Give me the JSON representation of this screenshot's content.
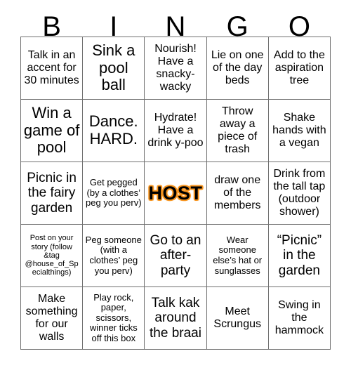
{
  "header": {
    "letters": [
      "B",
      "I",
      "N",
      "G",
      "O"
    ]
  },
  "colors": {
    "grid_line": "#6f6f6f",
    "cell_background": "#ffffff",
    "text": "#000000",
    "host_outline": "#f7941e"
  },
  "grid": {
    "rows": 5,
    "columns": 5,
    "cells": [
      {
        "text": "Talk in an accent for 30 minutes",
        "size": "fs-md",
        "free_space": false
      },
      {
        "text": "Sink a pool ball",
        "size": "fs-xl",
        "free_space": false
      },
      {
        "text": "Nourish! Have a snacky-wacky",
        "size": "fs-md",
        "free_space": false
      },
      {
        "text": "Lie on one of the day beds",
        "size": "fs-md",
        "free_space": false
      },
      {
        "text": "Add to the aspiration tree",
        "size": "fs-md",
        "free_space": false
      },
      {
        "text": "Win a game of pool",
        "size": "fs-xl",
        "free_space": false
      },
      {
        "text": "Dance. HARD.",
        "size": "fs-xl",
        "free_space": false
      },
      {
        "text": "Hydrate! Have a drink y-poo",
        "size": "fs-md",
        "free_space": false
      },
      {
        "text": "Throw away a piece of trash",
        "size": "fs-md",
        "free_space": false
      },
      {
        "text": "Shake hands with a vegan",
        "size": "fs-md",
        "free_space": false
      },
      {
        "text": "Picnic in the fairy garden",
        "size": "fs-lg",
        "free_space": false
      },
      {
        "text": "Get pegged (by a clothes’ peg you perv)",
        "size": "fs-sm",
        "free_space": false
      },
      {
        "text": "HOST",
        "size": "fs-xl",
        "free_space": true
      },
      {
        "text": "draw one of the members",
        "size": "fs-md",
        "free_space": false
      },
      {
        "text": "Drink from the tall tap (outdoor shower)",
        "size": "fs-md",
        "free_space": false
      },
      {
        "text": "Post on your story (follow &tag @house_of_Specialthings)",
        "size": "fs-xs",
        "free_space": false
      },
      {
        "text": "Peg someone (with a clothes’ peg you perv)",
        "size": "fs-sm",
        "free_space": false
      },
      {
        "text": "Go to an after-party",
        "size": "fs-lg",
        "free_space": false
      },
      {
        "text": "Wear someone else’s hat or sunglasses",
        "size": "fs-sm",
        "free_space": false
      },
      {
        "text": "“Picnic” in the garden",
        "size": "fs-lg",
        "free_space": false
      },
      {
        "text": "Make something for our walls",
        "size": "fs-md",
        "free_space": false
      },
      {
        "text": "Play rock, paper, scissors, winner ticks off this box",
        "size": "fs-sm",
        "free_space": false
      },
      {
        "text": "Talk kak around the braai",
        "size": "fs-lg",
        "free_space": false
      },
      {
        "text": "Meet Scrungus",
        "size": "fs-md",
        "free_space": false
      },
      {
        "text": "Swing in the hammock",
        "size": "fs-md",
        "free_space": false
      }
    ]
  }
}
